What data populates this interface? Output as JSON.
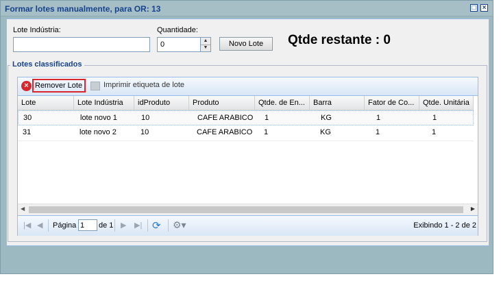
{
  "window": {
    "title": "Formar lotes manualmente, para OR: 13",
    "maximize_glyph": "□",
    "close_glyph": "×"
  },
  "form": {
    "lote_industria_label": "Lote Indústria:",
    "lote_industria_value": "",
    "quantidade_label": "Quantidade:",
    "quantidade_value": "0",
    "novo_lote_label": "Novo Lote",
    "qtde_restante_text": "Qtde restante : 0"
  },
  "section": {
    "legend": "Lotes classificados"
  },
  "toolbar": {
    "remove_label": "Remover Lote",
    "print_label": "Imprimir etiqueta de lote"
  },
  "grid": {
    "columns": [
      "Lote",
      "Lote Indústria",
      "idProduto",
      "Produto",
      "Qtde. de En...",
      "Barra",
      "Fator de Co...",
      "Qtde. Unitária"
    ],
    "rows": [
      [
        "30",
        "lote novo 1",
        "10",
        "CAFE ARABICO",
        "1",
        "KG",
        "1",
        "1"
      ],
      [
        "31",
        "lote novo 2",
        "10",
        "CAFE ARABICO",
        "1",
        "KG",
        "1",
        "1"
      ]
    ]
  },
  "pager": {
    "page_label": "Página",
    "page_value": "1",
    "of_label": "de 1",
    "display_text": "Exibindo 1 - 2 de 2"
  },
  "colors": {
    "accent": "#15428b",
    "highlight_border": "#d9262c",
    "remove_icon": "#d9262c"
  },
  "icons": [
    "close-icon",
    "maximize-icon",
    "remove-icon",
    "print-icon",
    "first-page-icon",
    "prev-page-icon",
    "next-page-icon",
    "last-page-icon",
    "refresh-icon",
    "settings-icon",
    "spin-up-icon",
    "spin-down-icon",
    "scroll-left-icon",
    "scroll-right-icon"
  ]
}
